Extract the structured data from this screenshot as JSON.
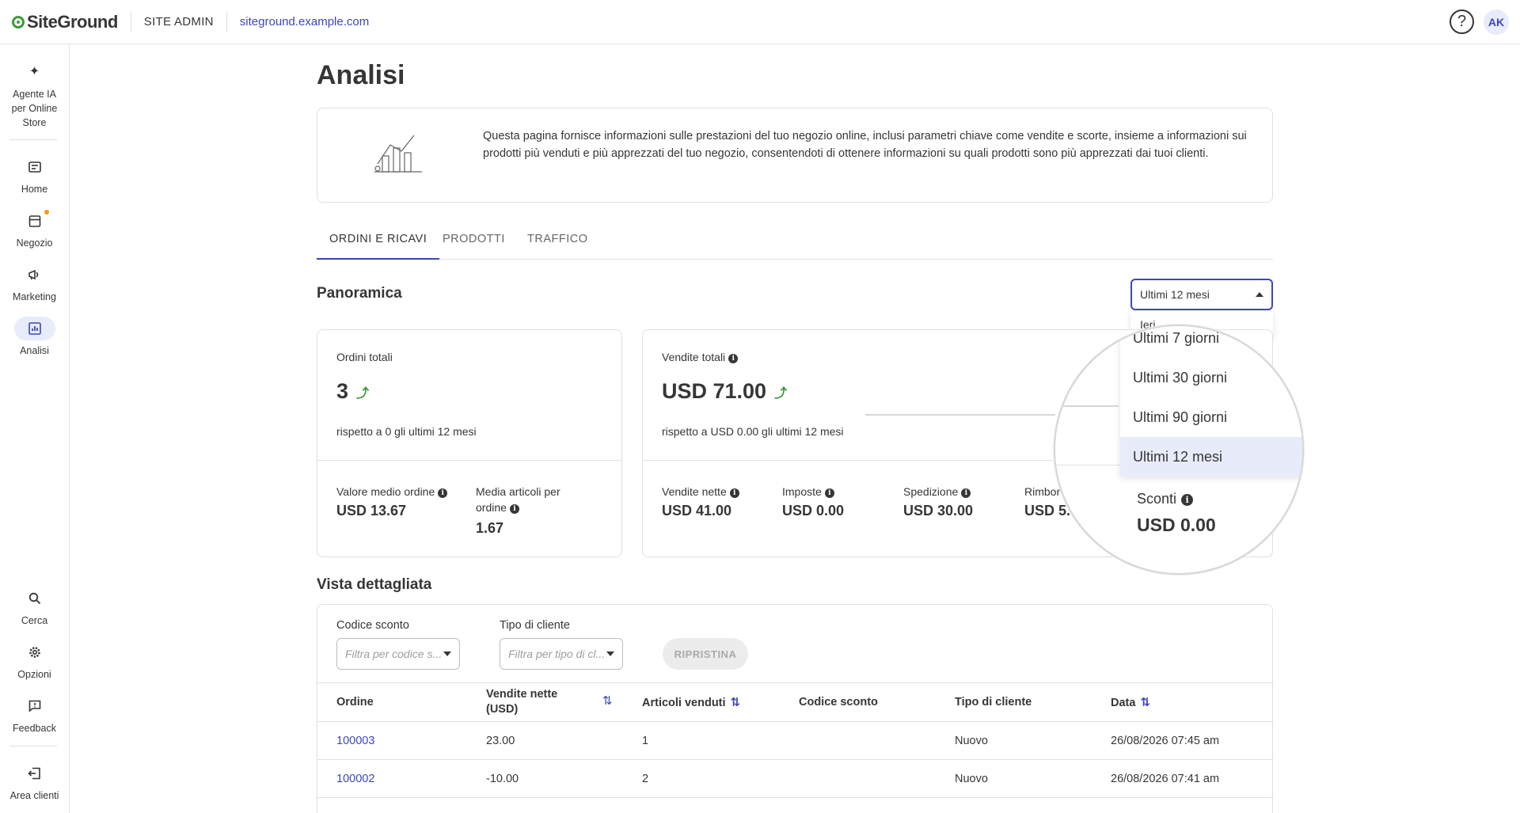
{
  "topbar": {
    "logo": "SiteGround",
    "section": "SITE ADMIN",
    "domain": "siteground.example.com",
    "help": "?",
    "avatar": "AK"
  },
  "sidebar": {
    "items": [
      {
        "label": "Agente IA per Online Store",
        "icon": "sparkle-icon"
      },
      {
        "label": "Home",
        "icon": "home-icon"
      },
      {
        "label": "Negozio",
        "icon": "store-icon"
      },
      {
        "label": "Marketing",
        "icon": "megaphone-icon"
      },
      {
        "label": "Analisi",
        "icon": "chart-icon"
      },
      {
        "label": "Cerca",
        "icon": "search-icon"
      },
      {
        "label": "Opzioni",
        "icon": "gear-icon"
      },
      {
        "label": "Feedback",
        "icon": "feedback-icon"
      },
      {
        "label": "Area clienti",
        "icon": "logout-icon"
      }
    ]
  },
  "page": {
    "title": "Analisi",
    "info": "Questa pagina fornisce informazioni sulle prestazioni del tuo negozio online, inclusi parametri chiave come vendite e scorte, insieme a informazioni sui prodotti più venduti e più apprezzati del tuo negozio, consentendoti di ottenere informazioni su quali prodotti sono più apprezzati dai tuoi clienti."
  },
  "tabs": [
    "ORDINI E RICAVI",
    "PRODOTTI",
    "TRAFFICO"
  ],
  "overview": {
    "title": "Panoramica",
    "period": "Ultimi 12 mesi",
    "period_options": [
      "Ieri",
      "Ultimi 7 giorni",
      "Ultimi 30 giorni",
      "Ultimi 90 giorni",
      "Ultimi 12 mesi"
    ],
    "orders": {
      "label": "Ordini totali",
      "value": "3",
      "compare": "rispetto a 0 gli ultimi 12 mesi",
      "avg_order_label": "Valore medio ordine",
      "avg_order_value": "USD 13.67",
      "avg_items_label": "Media articoli per ordine",
      "avg_items_value": "1.67"
    },
    "sales": {
      "label": "Vendite totali",
      "value": "USD 71.00",
      "compare": "rispetto a USD 0.00 gli ultimi 12 mesi",
      "net_label": "Vendite nette",
      "net_value": "USD 41.00",
      "tax_label": "Imposte",
      "tax_value": "USD 0.00",
      "ship_label": "Spedizione",
      "ship_value": "USD 30.00",
      "refund_label": "Rimbor",
      "refund_value": "USD 5.",
      "discount_label": "Sconti",
      "discount_value": "USD 0.00"
    }
  },
  "detail": {
    "title": "Vista dettagliata",
    "filter_discount_label": "Codice sconto",
    "filter_discount_placeholder": "Filtra per codice s...",
    "filter_customer_label": "Tipo di cliente",
    "filter_customer_placeholder": "Filtra per tipo di cl...",
    "reset": "RIPRISTINA",
    "columns": [
      "Ordine",
      "Vendite nette (USD)",
      "Articoli venduti",
      "Codice sconto",
      "Tipo di cliente",
      "Data"
    ],
    "rows": [
      {
        "order": "100003",
        "net": "23.00",
        "items": "1",
        "code": "",
        "type": "Nuovo",
        "date": "26/08/2026 07:45 am"
      },
      {
        "order": "100002",
        "net": "-10.00",
        "items": "2",
        "code": "",
        "type": "Nuovo",
        "date": "26/08/2026 07:41 am"
      }
    ]
  },
  "colors": {
    "accent": "#3d47b8",
    "trend": "#3c9a3b",
    "badge": "#f39c12"
  }
}
